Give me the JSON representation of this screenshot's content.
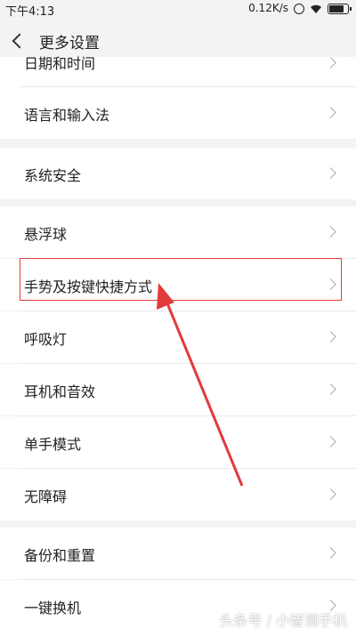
{
  "status": {
    "time": "下午4:13",
    "network_speed": "0.12K/s"
  },
  "header": {
    "title": "更多设置"
  },
  "items": [
    {
      "label": "日期和时间"
    },
    {
      "label": "语言和输入法"
    },
    {
      "label": "系统安全"
    },
    {
      "label": "悬浮球"
    },
    {
      "label": "手势及按键快捷方式"
    },
    {
      "label": "呼吸灯"
    },
    {
      "label": "耳机和音效"
    },
    {
      "label": "单手模式"
    },
    {
      "label": "无障碍"
    },
    {
      "label": "备份和重置"
    },
    {
      "label": "一键换机"
    }
  ],
  "watermark": "头条号 / 小智测手机",
  "colors": {
    "highlight": "#e23b3b",
    "background": "#f3f3f3",
    "row": "#ffffff"
  }
}
